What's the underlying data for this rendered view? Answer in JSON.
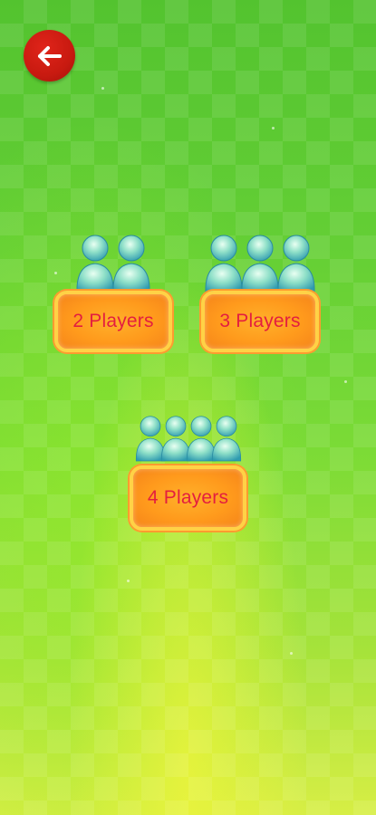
{
  "colors": {
    "accent_text": "#e41e3f",
    "button_fill": "#ff9a1c",
    "back_button": "#c81a10",
    "background": "#64cf35"
  },
  "back_button": {
    "icon": "arrow-left-icon"
  },
  "options": [
    {
      "label": "2 Players",
      "player_count": 2,
      "icon": "person-icon"
    },
    {
      "label": "3 Players",
      "player_count": 3,
      "icon": "person-icon"
    },
    {
      "label": "4 Players",
      "player_count": 4,
      "icon": "person-icon"
    }
  ]
}
